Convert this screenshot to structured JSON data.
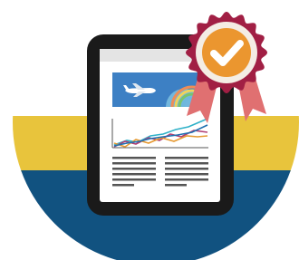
{
  "illustration": {
    "icons": [
      "tablet-icon",
      "airplane-icon",
      "line-chart-icon",
      "text-columns-icon",
      "award-ribbon-icon",
      "checkmark-icon"
    ],
    "colors": {
      "background": "#ffffff",
      "band_yellow": "#e8c43c",
      "band_navy": "#115280",
      "tablet_frame": "#1a1a1a",
      "screen": "#ffffff",
      "banner_blue": "#3d80c4",
      "series_1": "#2fb1c8",
      "series_2": "#b03f75",
      "series_3": "#e69a32",
      "series_4": "#1f6fb0",
      "text_lines": "#555555",
      "badge_rosette": "#a11f44",
      "badge_ring": "#f4ede4",
      "badge_medal": "#eb962f",
      "badge_ribbon": "#e07071",
      "checkmark": "#ffffff"
    }
  }
}
